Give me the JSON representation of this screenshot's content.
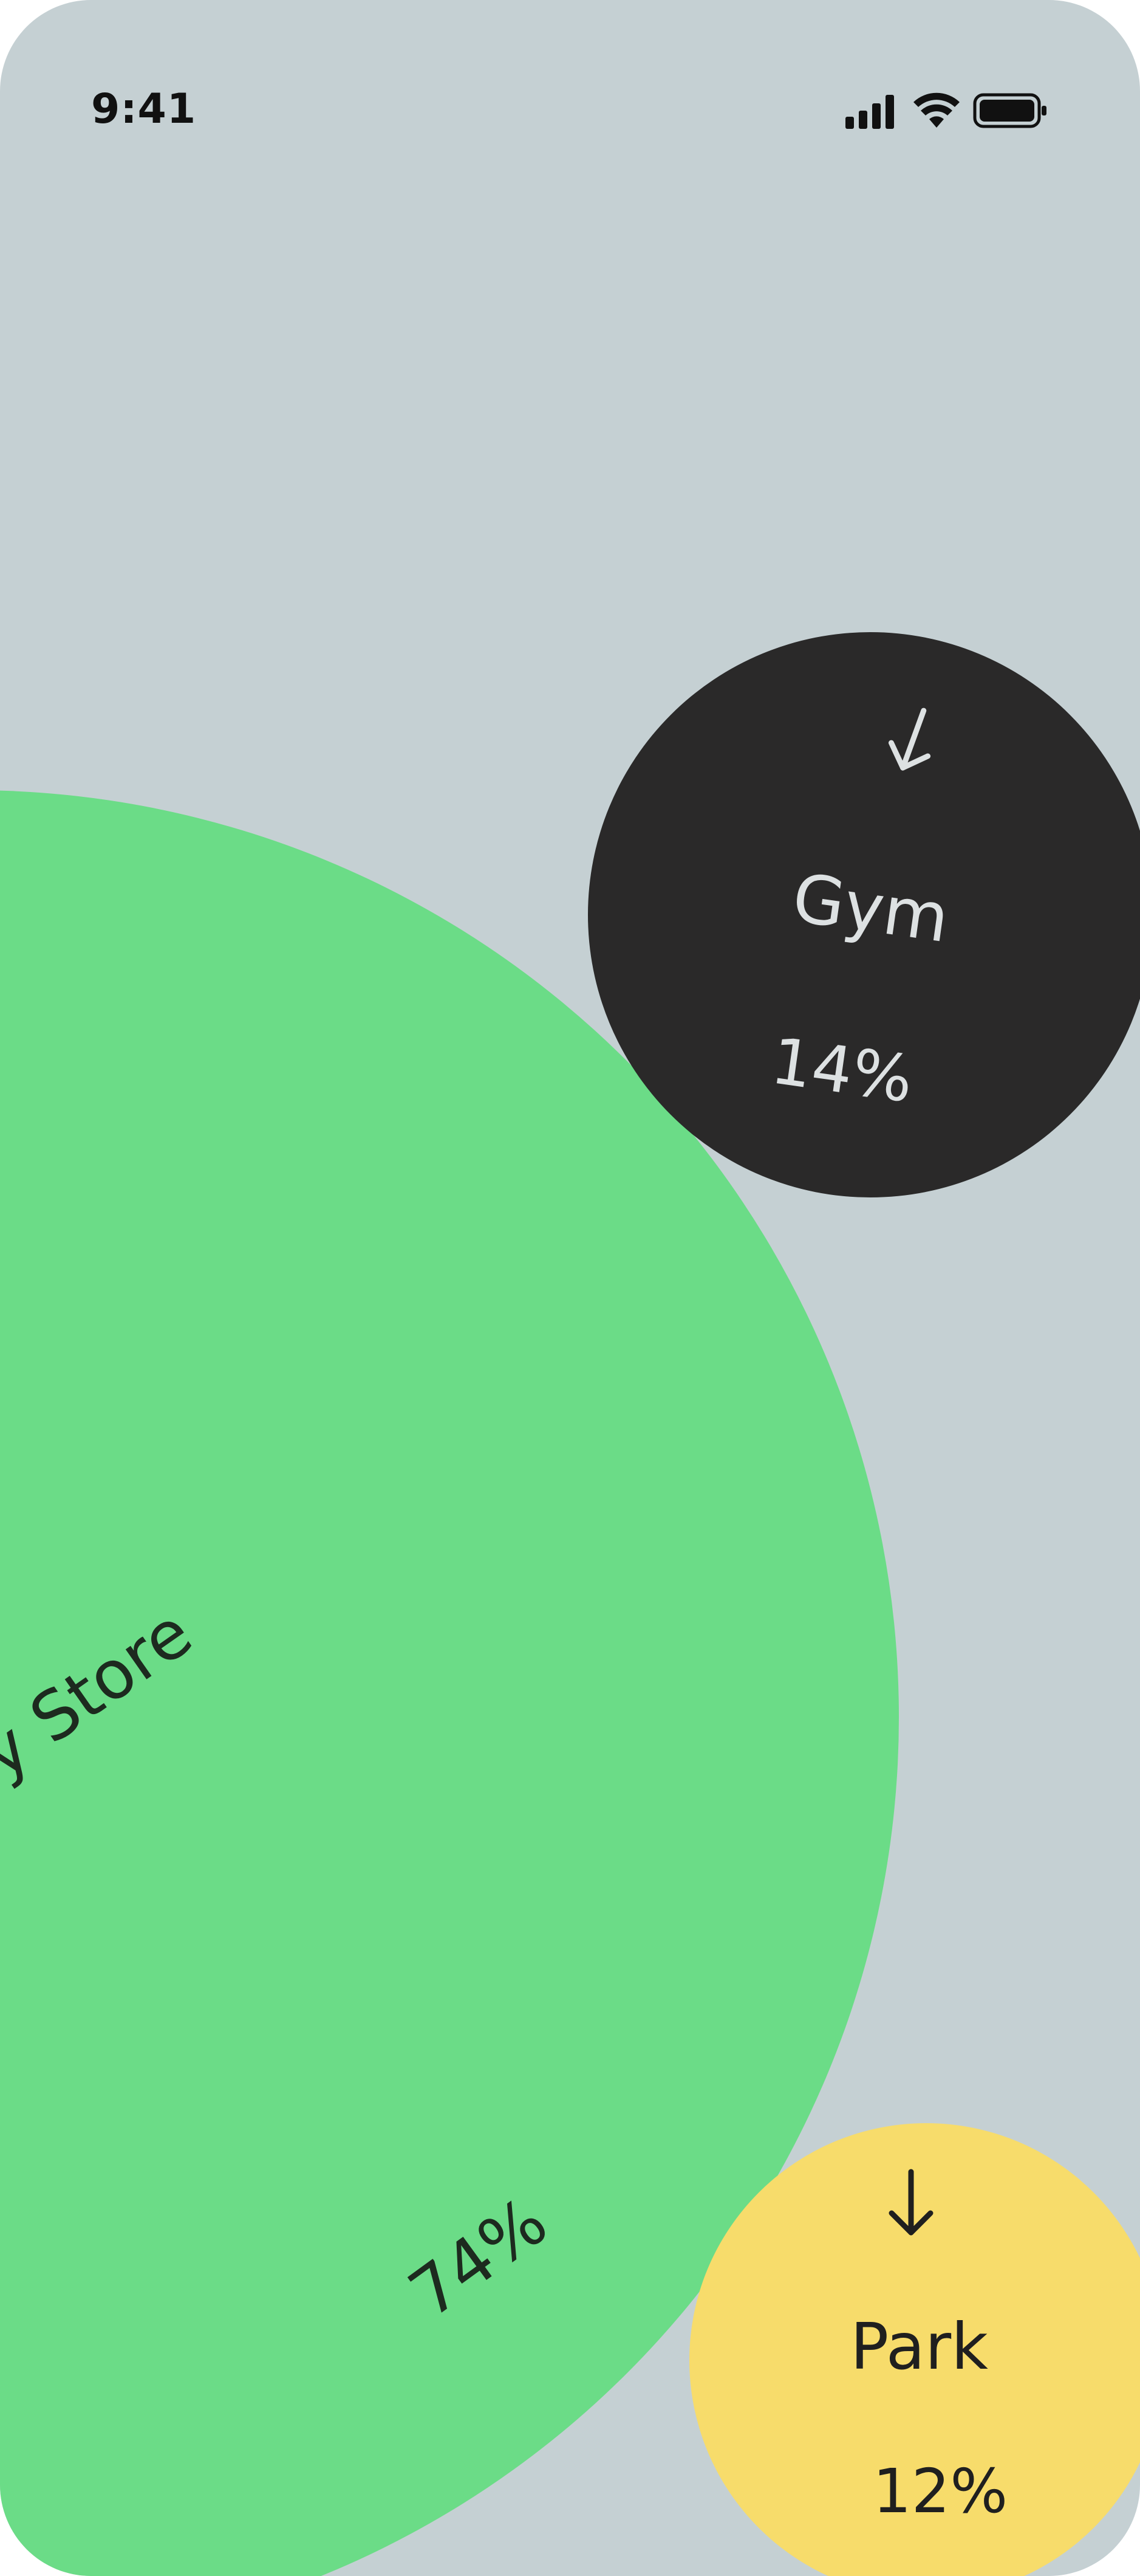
{
  "status_bar": {
    "time": "9:41",
    "icons": [
      "cellular-signal-icon",
      "wifi-icon",
      "battery-icon"
    ]
  },
  "colors": {
    "background": "#c5d0d3",
    "store": "#6bdc87",
    "gym": "#2a2929",
    "park": "#f7dc6b"
  },
  "bubbles": [
    {
      "name": "y Store",
      "percent": "74%"
    },
    {
      "name": "Gym",
      "percent": "14%",
      "arrow": "arrow-down-icon"
    },
    {
      "name": "Park",
      "percent": "12%",
      "arrow": "arrow-down-icon"
    }
  ]
}
